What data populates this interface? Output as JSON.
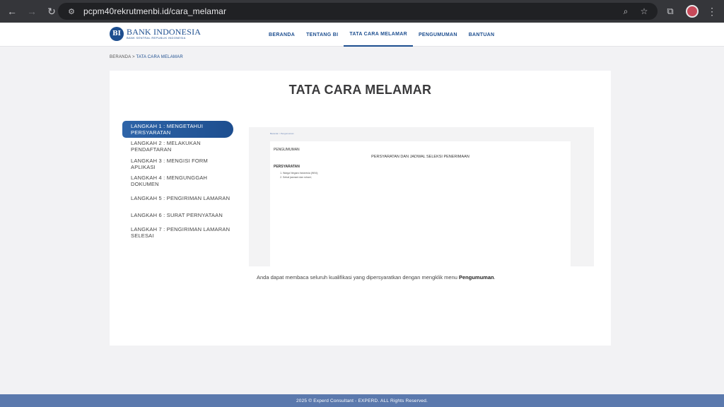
{
  "browser": {
    "url": "pcpm40rekrutmenbi.id/cara_melamar",
    "back_icon": "←",
    "forward_icon": "→",
    "reload_icon": "↻",
    "site_info_icon": "⚙",
    "zoom_icon": "⌕",
    "star_icon": "☆",
    "extensions_icon": "⧉",
    "menu_icon": "⋮"
  },
  "header": {
    "logo_mark": "BI",
    "logo_name": "BANK INDONESIA",
    "logo_sub": "BANK SENTRAL REPUBLIK INDONESIA",
    "nav": [
      {
        "label": "BERANDA"
      },
      {
        "label": "TENTANG BI"
      },
      {
        "label": "TATA CARA MELAMAR"
      },
      {
        "label": "PENGUMUMAN"
      },
      {
        "label": "BANTUAN"
      }
    ],
    "active_color": "#1d4e8f"
  },
  "breadcrumb": {
    "home": "BERANDA",
    "separator": ">",
    "current": "TATA CARA MELAMAR"
  },
  "main": {
    "title": "TATA CARA MELAMAR",
    "steps": [
      {
        "label": "LANGKAH 1 : MENGETAHUI PERSYARATAN"
      },
      {
        "label": "LANGKAH 2 : MELAKUKAN PENDAFTARAN"
      },
      {
        "label": "LANGKAH 3 : MENGISI FORM APLIKASI"
      },
      {
        "label": "LANGKAH 4 : MENGUNGGAH DOKUMEN"
      },
      {
        "label": "LANGKAH 5 : PENGIRIMAN LAMARAN"
      },
      {
        "label": "LANGKAH 6 : SURAT PERNYATAAN"
      },
      {
        "label": "LANGKAH 7 : PENGIRIMAN LAMARAN SELESAI"
      }
    ],
    "preview": {
      "breadcrumb": "Beranda > Pengumuman",
      "page_label": "PENGUMUMAN",
      "heading": "PERSYARATAN DAN JADWAL SELEKSI PENERIMAAN",
      "section": "PERSYARATAN",
      "items": [
        "Warga Negara Indonesia (WNI);",
        "Sehat jasmani dan rohani;"
      ]
    },
    "desc_prefix": "Anda dapat membaca seluruh kualifikasi yang dipersyaratkan dengan mengklik menu ",
    "desc_bold": "Pengumuman",
    "desc_suffix": "."
  },
  "footer": {
    "text": "2025 © Experd Consultant - EXPERD. ALL Rights Reserved."
  }
}
